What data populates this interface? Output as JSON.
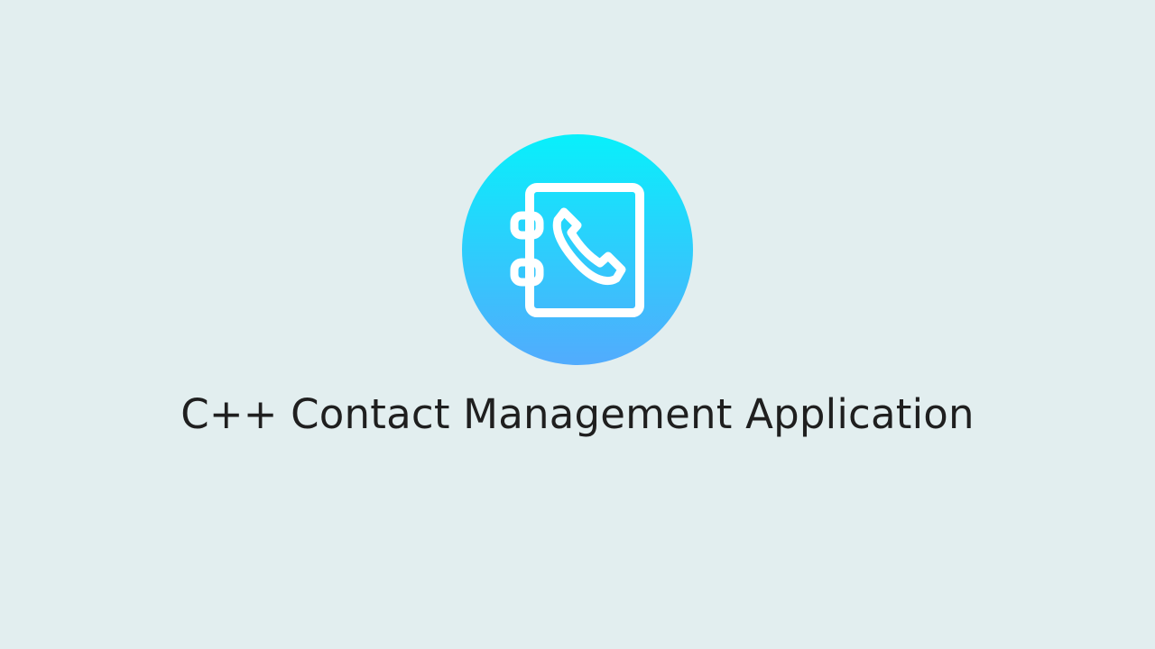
{
  "hero": {
    "icon": "address-book-phone-icon",
    "accent_top": "#08f0fb",
    "accent_bottom": "#52abfd",
    "title": "C++ Contact Management Application"
  }
}
